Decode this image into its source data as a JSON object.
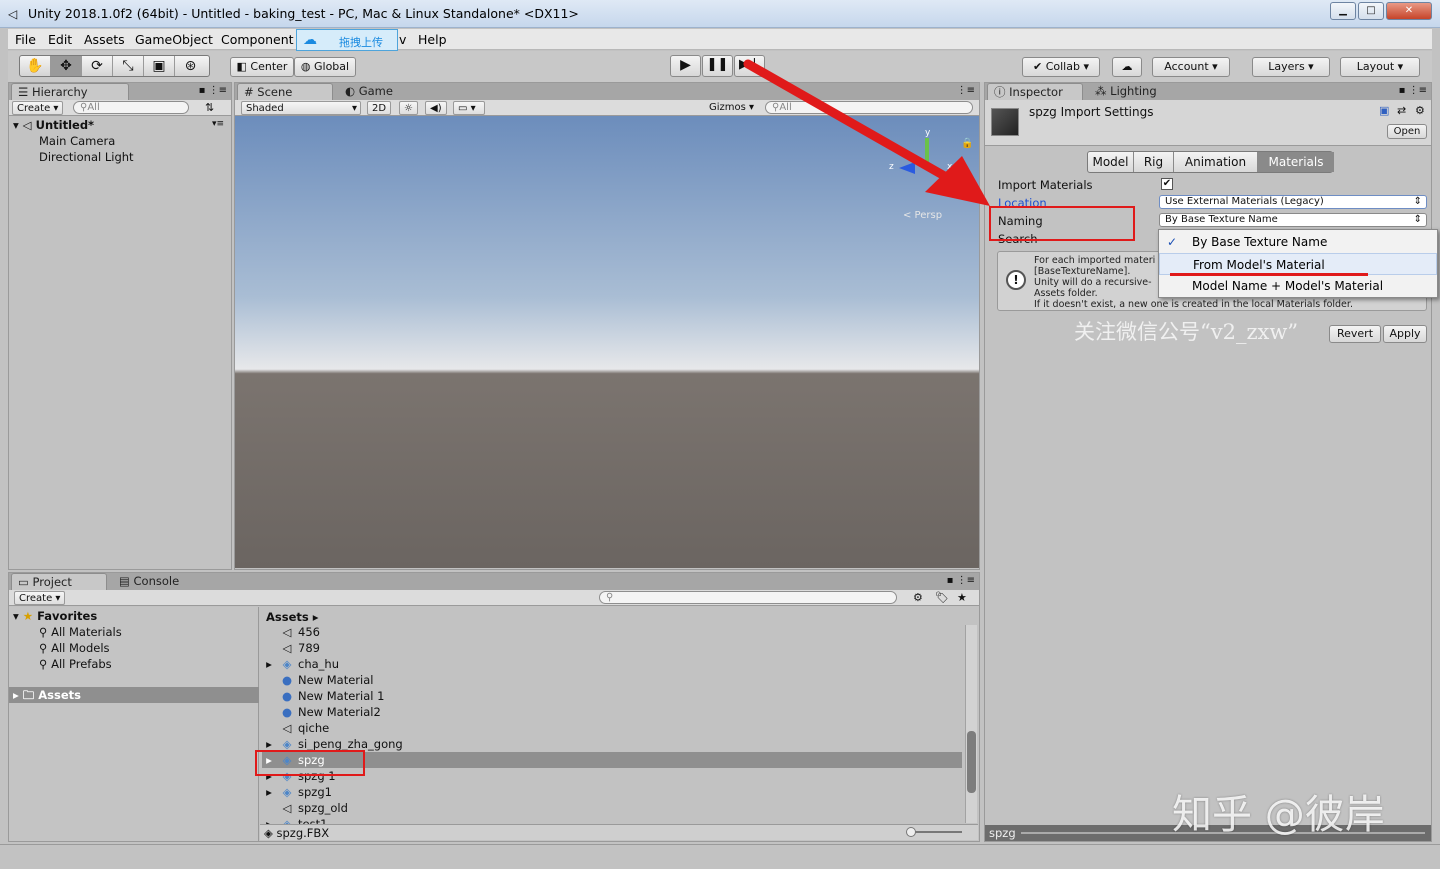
{
  "window": {
    "title": "Unity 2018.1.0f2 (64bit) - Untitled - baking_test - PC, Mac & Linux Standalone* <DX11>"
  },
  "menu": {
    "items": [
      "File",
      "Edit",
      "Assets",
      "GameObject",
      "Component"
    ],
    "help": "Help",
    "upload_label": "拖拽上传",
    "upload_tail": "v"
  },
  "toolbar": {
    "center": "Center",
    "global": "Global",
    "collab": "Collab",
    "account": "Account",
    "layers": "Layers",
    "layout": "Layout"
  },
  "hierarchy": {
    "tab": "Hierarchy",
    "create": "Create",
    "search_placeholder": "All",
    "scene_name": "Untitled*",
    "items": [
      "Main Camera",
      "Directional Light"
    ]
  },
  "scene": {
    "tab_scene": "Scene",
    "tab_game": "Game",
    "shading": "Shaded",
    "mode_2d": "2D",
    "gizmos": "Gizmos",
    "search_placeholder": "All",
    "gizmo_x": "x",
    "gizmo_y": "y",
    "gizmo_z": "z",
    "persp": "< Persp"
  },
  "project": {
    "tab_project": "Project",
    "tab_console": "Console",
    "create": "Create",
    "favorites_label": "Favorites",
    "favorites": [
      "All Materials",
      "All Models",
      "All Prefabs"
    ],
    "assets_label": "Assets",
    "breadcrumb": "Assets",
    "assets": [
      {
        "name": "456",
        "icon": "unity-scene-icon",
        "expandable": false
      },
      {
        "name": "789",
        "icon": "unity-scene-icon",
        "expandable": false
      },
      {
        "name": "cha_hu",
        "icon": "model-icon",
        "expandable": true
      },
      {
        "name": "New Material",
        "icon": "material-icon",
        "expandable": false
      },
      {
        "name": "New Material 1",
        "icon": "material-icon",
        "expandable": false
      },
      {
        "name": "New Material2",
        "icon": "material-icon",
        "expandable": false
      },
      {
        "name": "qiche",
        "icon": "unity-scene-icon",
        "expandable": false
      },
      {
        "name": "si_peng_zha_gong",
        "icon": "model-icon",
        "expandable": true
      },
      {
        "name": "spzg",
        "icon": "model-icon",
        "expandable": true,
        "selected": true
      },
      {
        "name": "spzg 1",
        "icon": "model-icon",
        "expandable": true
      },
      {
        "name": "spzg1",
        "icon": "model-icon",
        "expandable": true
      },
      {
        "name": "spzg_old",
        "icon": "unity-scene-icon",
        "expandable": false
      },
      {
        "name": "test1",
        "icon": "model-icon",
        "expandable": true
      }
    ],
    "status_file": "spzg.FBX"
  },
  "inspector": {
    "tab": "Inspector",
    "tab_lighting": "Lighting",
    "title": "spzg Import Settings",
    "open": "Open",
    "tabs": [
      "Model",
      "Rig",
      "Animation",
      "Materials"
    ],
    "active_tab": "Materials",
    "import_materials_label": "Import Materials",
    "location_label": "Location",
    "location_value": "Use External Materials (Legacy)",
    "naming_label": "Naming",
    "naming_value": "By Base Texture Name",
    "search_label": "Search",
    "help_lines": [
      "For each imported materi",
      "[BaseTextureName].",
      "Unity will do a recursive-",
      "Assets folder.",
      "If it doesn't exist, a new one is created in the local Materials folder."
    ],
    "revert": "Revert",
    "apply": "Apply",
    "footer": "spzg"
  },
  "popup": {
    "options": [
      "By Base Texture Name",
      "From Model's Material",
      "Model Name + Model's Material"
    ],
    "checked": 0,
    "highlighted": 1
  },
  "watermarks": {
    "wechat": "关注微信公号“v2_zxw”",
    "zhihu": "知乎 @彼岸"
  },
  "colors": {
    "annotation_red": "#e01a1a",
    "selection": "#3d6cb8"
  }
}
